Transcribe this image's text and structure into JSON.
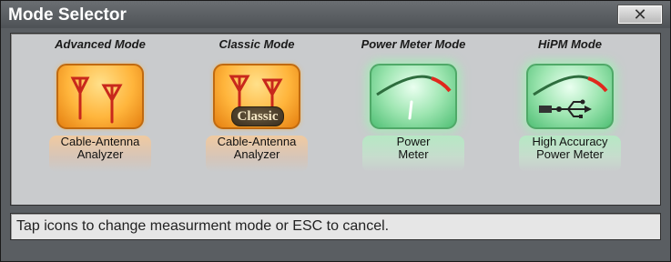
{
  "window": {
    "title": "Mode Selector",
    "close_label": "✕"
  },
  "modes": [
    {
      "title": "Advanced Mode",
      "label_lines": [
        "Cable-Antenna",
        "Analyzer"
      ],
      "icon": "antenna-icon",
      "color": "#ffb53c"
    },
    {
      "title": "Classic Mode",
      "label_lines": [
        "Cable-Antenna",
        "Analyzer"
      ],
      "icon": "antenna-classic-icon",
      "badge": "Classic",
      "color": "#ffb53c"
    },
    {
      "title": "Power Meter Mode",
      "label_lines": [
        "Power",
        "Meter"
      ],
      "icon": "gauge-icon",
      "color": "#9fe6b2"
    },
    {
      "title": "HiPM Mode",
      "label_lines": [
        "High Accuracy",
        "Power Meter"
      ],
      "icon": "gauge-usb-icon",
      "color": "#9fe6b2"
    }
  ],
  "status": {
    "text": "Tap icons to change measurment mode or ESC to cancel."
  }
}
